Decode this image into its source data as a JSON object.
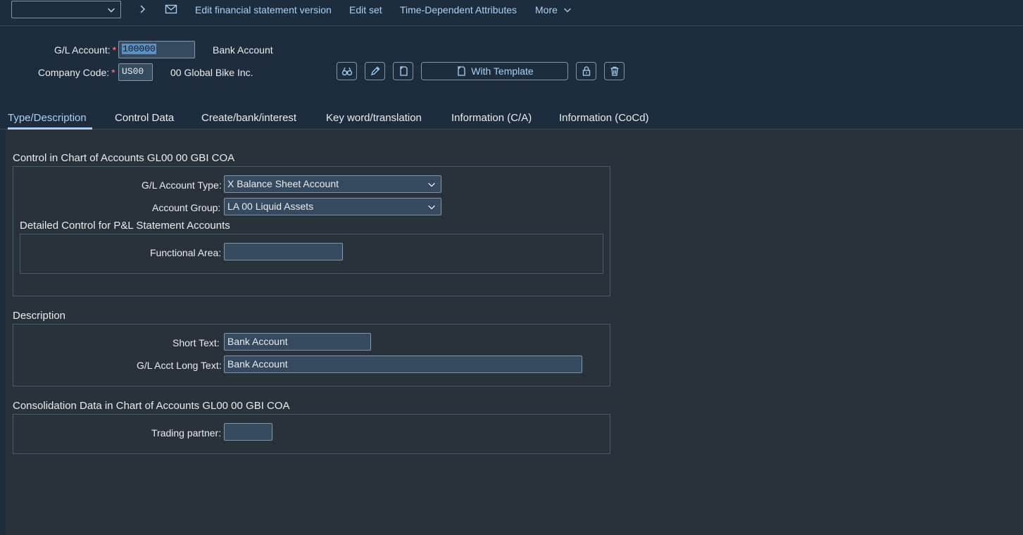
{
  "toolbar": {
    "command_field_value": "",
    "links": {
      "edit_fs_version": "Edit financial statement version",
      "edit_set": "Edit set",
      "time_dependent": "Time-Dependent Attributes",
      "more": "More"
    },
    "icons": [
      "chevron-down-icon",
      "chevron-right-icon",
      "envelope-icon",
      "chevron-down-icon"
    ]
  },
  "header": {
    "gl_account_label": "G/L Account:",
    "gl_account_value": "100000",
    "gl_account_desc": "Bank Account",
    "company_code_label": "Company Code:",
    "company_code_value": "US00",
    "company_code_desc": "00 Global Bike Inc.",
    "required_marker": "*",
    "buttons": {
      "with_template": "With Template"
    },
    "button_icons": [
      "binoculars-icon",
      "pencil-icon",
      "document-icon",
      "lock-icon",
      "trash-icon"
    ]
  },
  "tabs": [
    {
      "label": "Type/Description",
      "active": true
    },
    {
      "label": "Control Data",
      "active": false
    },
    {
      "label": "Create/bank/interest",
      "active": false
    },
    {
      "label": "Key word/translation",
      "active": false
    },
    {
      "label": "Information (C/A)",
      "active": false
    },
    {
      "label": "Information (CoCd)",
      "active": false
    }
  ],
  "control": {
    "title": "Control in Chart of Accounts GL00 00 GBI COA",
    "account_type_label": "G/L Account Type:",
    "account_type_value": "X Balance Sheet Account",
    "account_group_label": "Account Group:",
    "account_group_value": "LA 00 Liquid Assets",
    "pl_title": "Detailed Control for P&L Statement Accounts",
    "functional_area_label": "Functional Area:",
    "functional_area_value": ""
  },
  "description": {
    "title": "Description",
    "short_text_label": "Short Text:",
    "short_text_value": "Bank Account",
    "long_text_label": "G/L Acct Long Text:",
    "long_text_value": "Bank Account"
  },
  "consolidation": {
    "title": "Consolidation Data in Chart of Accounts GL00 00 GBI COA",
    "trading_partner_label": "Trading partner:",
    "trading_partner_value": ""
  },
  "colors": {
    "shell": "#1d2d3e",
    "background": "#29313a",
    "link": "#a9d1f5",
    "field": "#354a5f",
    "border": "#8396a8"
  }
}
